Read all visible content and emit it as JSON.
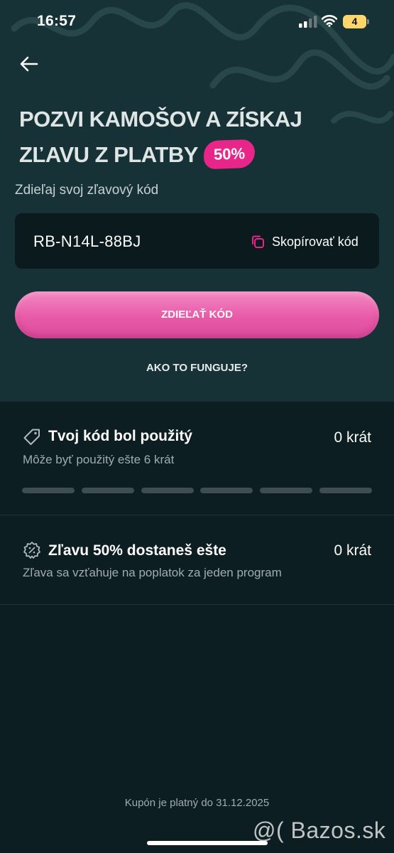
{
  "status_bar": {
    "time": "16:57",
    "battery": "4"
  },
  "header": {
    "title_line1": "POZVI KAMOŠOV A ZÍSKAJ",
    "title_line2": "ZĽAVU Z PLATBY",
    "badge": "50%",
    "subtitle": "Zdieľaj svoj zľavový kód"
  },
  "code": {
    "value": "RB-N14L-88BJ",
    "copy_label": "Skopírovať kód"
  },
  "share_button_label": "ZDIEĽAŤ KÓD",
  "how_it_works_label": "AKO TO FUNGUJE?",
  "stats": {
    "used": {
      "title": "Tvoj kód bol použitý",
      "count": "0 krát",
      "subtitle": "Môže byť použitý ešte 6 krát",
      "uses_max": 6,
      "uses_done": 0
    },
    "discount": {
      "title": "Zľavu 50% dostaneš ešte",
      "count": "0 krát",
      "subtitle": "Zľava sa vzťahuje na poplatok za jeden program"
    }
  },
  "footer_note": "Kupón je platný do 31.12.2025",
  "watermark": "@( Bazos.sk",
  "colors": {
    "accent": "#e8268a",
    "button": "#e85aa8",
    "top_bg": "#163237",
    "bottom_bg": "#0c1e22"
  }
}
